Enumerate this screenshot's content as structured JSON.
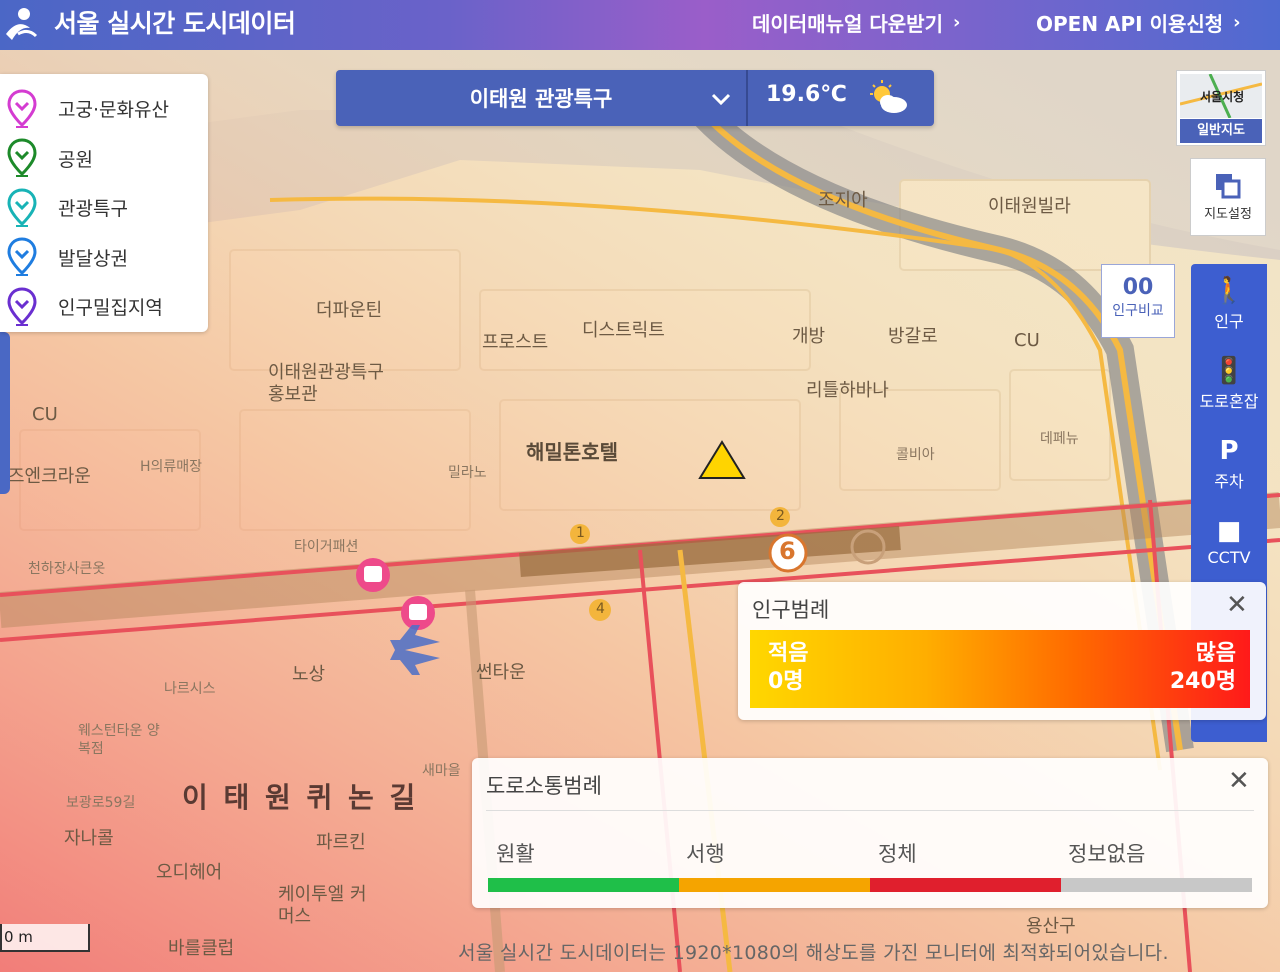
{
  "header": {
    "title": "서울 실시간 도시데이터",
    "manual_link": "데이터매뉴얼 다운받기",
    "api_link": "OPEN API 이용신청",
    "chevron": "›"
  },
  "categories": [
    {
      "label": "고궁·문화유산",
      "color": "#d43cd1"
    },
    {
      "label": "공원",
      "color": "#1d8a2a"
    },
    {
      "label": "관광특구",
      "color": "#18b3b6"
    },
    {
      "label": "발달상권",
      "color": "#1f7de0"
    },
    {
      "label": "인구밀집지역",
      "color": "#6a2fd0"
    }
  ],
  "area_selector": {
    "area_name": "이태원 관광특구",
    "temperature": "19.6℃",
    "weather_icon": "partly-cloudy-icon"
  },
  "map_type": {
    "thumb_text": "서울시청",
    "label": "일반지도"
  },
  "map_setting": {
    "label": "지도설정"
  },
  "population_compare": {
    "icon_text": "00",
    "label": "인구비교"
  },
  "side_tools": [
    {
      "icon": "person-icon",
      "glyph": "🚶",
      "label": "인구"
    },
    {
      "icon": "traffic-light-icon",
      "glyph": "🚦",
      "label": "도로혼잡"
    },
    {
      "icon": "parking-icon",
      "glyph": "P",
      "label": "주차"
    },
    {
      "icon": "cctv-icon",
      "glyph": "■",
      "label": "CCTV"
    }
  ],
  "population_legend": {
    "title": "인구범례",
    "low_label": "적음",
    "low_value": "0명",
    "high_label": "많음",
    "high_value": "240명",
    "close": "✕"
  },
  "traffic_legend": {
    "title": "도로소통범례",
    "close": "✕",
    "levels": [
      {
        "label": "원활",
        "color": "#1fbf49"
      },
      {
        "label": "서행",
        "color": "#f5a400"
      },
      {
        "label": "정체",
        "color": "#e01f2d"
      },
      {
        "label": "정보없음",
        "color": "#c8c8c8"
      }
    ]
  },
  "map_labels": {
    "street": "이 태 원 퀴 논 길",
    "hotel": "해밀톤호텔",
    "district": "디스트릭트",
    "frost": "프로스트",
    "depa": "더파운틴",
    "bangal": "방갈로",
    "gaebang": "개방",
    "rititu": "리틀하바나",
    "center": "이태원관광특구 홍보관",
    "cu1": "CU",
    "cu2": "CU",
    "villa": "이태원빌라",
    "joji": "조지아",
    "depaen": "데페뉴",
    "kembia": "콜비아",
    "milano": "밀라노",
    "hmall": "H의류매장",
    "tiago": "타이거패션",
    "nosang": "노상",
    "sseontaun": "썬타운",
    "naresi": "나르시스",
    "westown": "웨스턴타운 양복점",
    "jana": "자나콜",
    "pareukin": "파르킨",
    "odie": "오디헤어",
    "keitu": "케이투엘 커머스",
    "bareul": "바를클럽",
    "yongsan": "용산구",
    "seomal": "새마을",
    "cheonha": "천하장사큰옷",
    "jeukram": "즈엔크라운",
    "bogwang": "보광로59길",
    "station_no": "6",
    "exit1": "1",
    "exit2": "2",
    "exit4": "4"
  },
  "notice": "서울 실시간 도시데이터는 1920*1080의 해상도를 가진 모니터에 최적화되어있습니다.",
  "scale": "0 m"
}
